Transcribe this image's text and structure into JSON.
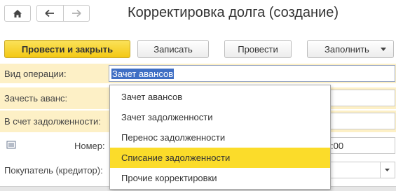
{
  "window": {
    "title": "Корректировка долга (создание)",
    "home_icon": "home-icon",
    "back_icon": "arrow-left-icon",
    "forward_icon": "arrow-right-icon"
  },
  "toolbar": {
    "post_close_label": "Провести и закрыть",
    "save_label": "Записать",
    "post_label": "Провести",
    "fill_label": "Заполнить"
  },
  "form": {
    "operation_type_label": "Вид операции:",
    "operation_type_value": "Зачет авансов",
    "offset_advance_label": "Зачесть аванс:",
    "against_debt_label": "В счет задолженности:",
    "number_label": "Номер:",
    "time_fragment": ":00",
    "buyer_label": "Покупатель (кредитор):"
  },
  "dropdown": {
    "items": [
      {
        "label": "Зачет авансов"
      },
      {
        "label": "Зачет задолженности"
      },
      {
        "label": "Перенос задолженности"
      },
      {
        "label": "Списание задолженности"
      },
      {
        "label": "Прочие корректировки"
      }
    ],
    "highlighted_index": 3
  },
  "colors": {
    "accent_yellow": "#fbdc2a",
    "primary_button": "#f3c814",
    "selection_blue": "#3f6fc4",
    "row_highlight": "#fdf0c6"
  }
}
